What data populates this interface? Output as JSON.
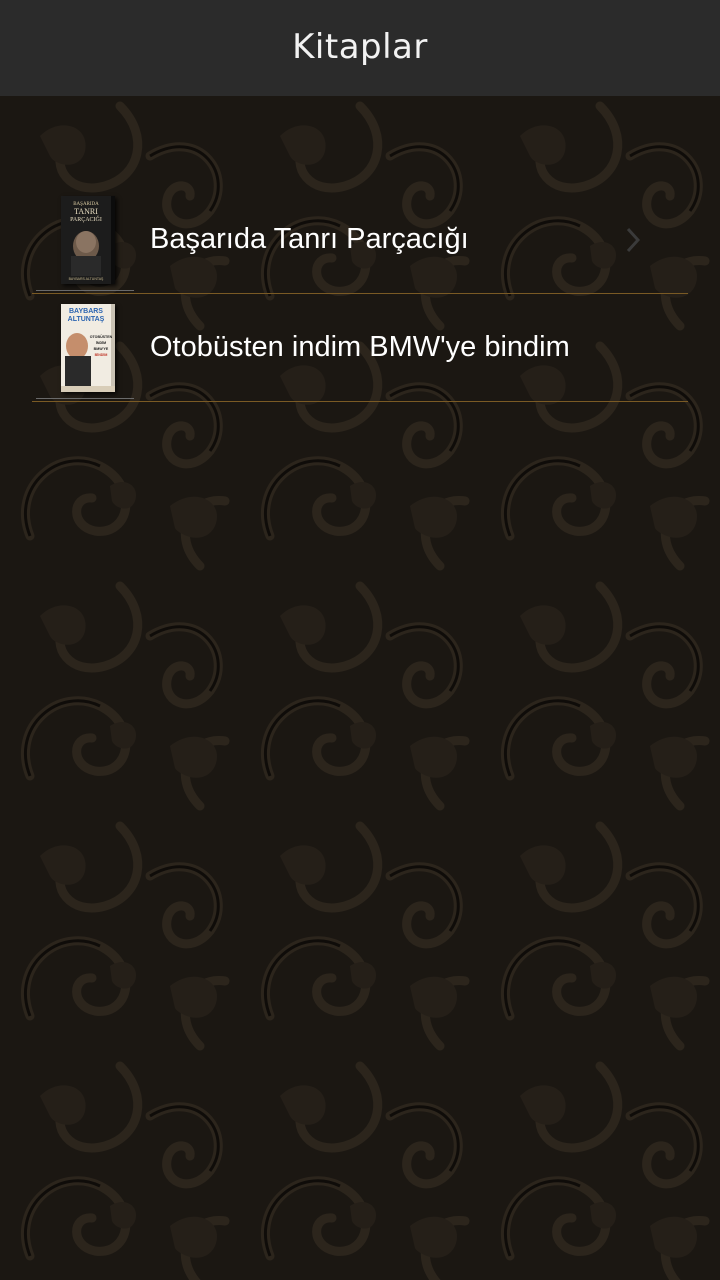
{
  "header": {
    "title": "Kitaplar"
  },
  "books": [
    {
      "title": "Başarıda Tanrı Parçacığı",
      "cover_icon": "book-cover-basarida-tanri-parcacigi",
      "cover_lettering": [
        "BAŞARIDA",
        "TANRI",
        "PARÇACIĞI",
        "BAYBARS ALTUNTAŞ"
      ]
    },
    {
      "title": "Otobüsten indim BMW'ye bindim",
      "cover_icon": "book-cover-otobusten-indim",
      "cover_lettering": [
        "BAYBARS",
        "ALTUNTAŞ",
        "OTOBÜSTEN",
        "İNDİM",
        "BMW'YE",
        "BİNDİM"
      ]
    }
  ],
  "colors": {
    "header_bg": "#2b2b2b",
    "divider": "#7a5a24",
    "background": "#1a1611"
  }
}
